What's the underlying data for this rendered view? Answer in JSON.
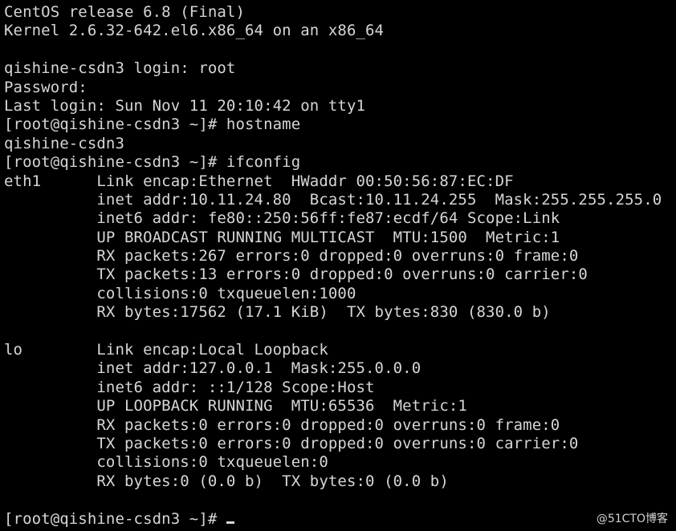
{
  "terminal": {
    "lines": [
      "CentOS release 6.8 (Final)",
      "Kernel 2.6.32-642.el6.x86_64 on an x86_64",
      "",
      "qishine-csdn3 login: root",
      "Password:",
      "Last login: Sun Nov 11 20:10:42 on tty1",
      "[root@qishine-csdn3 ~]# hostname",
      "qishine-csdn3",
      "[root@qishine-csdn3 ~]# ifconfig",
      "eth1      Link encap:Ethernet  HWaddr 00:50:56:87:EC:DF",
      "          inet addr:10.11.24.80  Bcast:10.11.24.255  Mask:255.255.255.0",
      "          inet6 addr: fe80::250:56ff:fe87:ecdf/64 Scope:Link",
      "          UP BROADCAST RUNNING MULTICAST  MTU:1500  Metric:1",
      "          RX packets:267 errors:0 dropped:0 overruns:0 frame:0",
      "          TX packets:13 errors:0 dropped:0 overruns:0 carrier:0",
      "          collisions:0 txqueuelen:1000",
      "          RX bytes:17562 (17.1 KiB)  TX bytes:830 (830.0 b)",
      "",
      "lo        Link encap:Local Loopback",
      "          inet addr:127.0.0.1  Mask:255.0.0.0",
      "          inet6 addr: ::1/128 Scope:Host",
      "          UP LOOPBACK RUNNING  MTU:65536  Metric:1",
      "          RX packets:0 errors:0 dropped:0 overruns:0 frame:0",
      "          TX packets:0 errors:0 dropped:0 overruns:0 carrier:0",
      "          collisions:0 txqueuelen:0",
      "          RX bytes:0 (0.0 b)  TX bytes:0 (0.0 b)",
      "",
      "[root@qishine-csdn3 ~]# "
    ]
  },
  "watermark": {
    "text": "@51CTO博客"
  },
  "colors": {
    "background": "#000000",
    "text": "#d6d6d6"
  }
}
